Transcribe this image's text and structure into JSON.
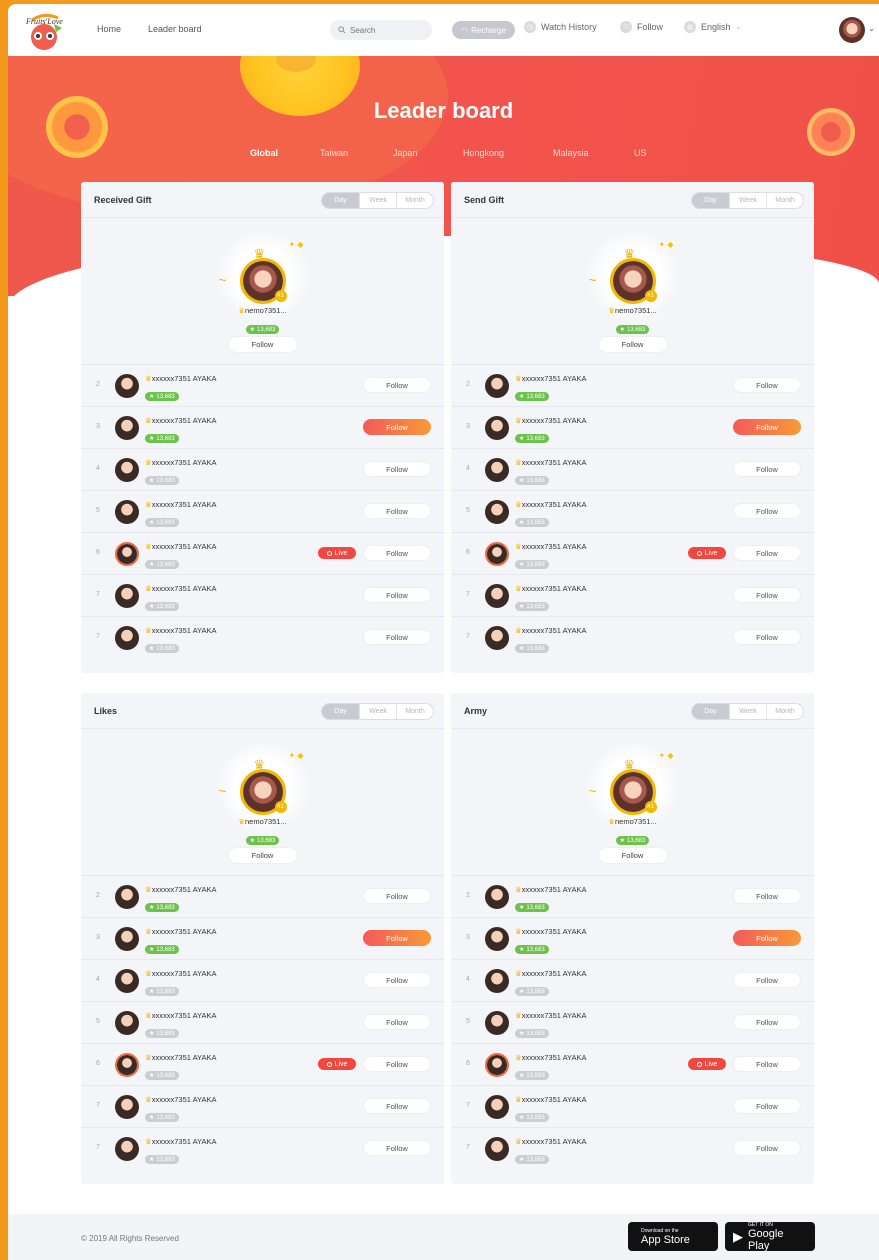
{
  "nav": {
    "home": "Home",
    "leaderboard": "Leader board",
    "search_placeholder": "Search",
    "recharge": "Recharge",
    "watch_history": "Watch History",
    "follow": "Follow",
    "language": "English"
  },
  "hero": {
    "title": "Leader board",
    "regions": [
      "Global",
      "Taiwan",
      "Japan",
      "Hongkong",
      "Malaysia",
      "US"
    ],
    "active_region": "Global"
  },
  "periods": [
    "Day",
    "Week",
    "Month"
  ],
  "panels": [
    {
      "title": "Received Gift",
      "top": {
        "name": "nemo7351...",
        "score": "13,683",
        "follow": "Follow"
      },
      "rows": [
        {
          "rank": "2",
          "name": "xxxxxx7351 AYAKA",
          "score": "13,683",
          "scoreColor": "green",
          "follow": "Follow",
          "hot": false,
          "live": false
        },
        {
          "rank": "3",
          "name": "xxxxxx7351 AYAKA",
          "score": "13,683",
          "scoreColor": "green",
          "follow": "Follow",
          "hot": true,
          "live": false
        },
        {
          "rank": "4",
          "name": "xxxxxx7351 AYAKA",
          "score": "13,683",
          "scoreColor": "grey",
          "follow": "Follow",
          "hot": false,
          "live": false
        },
        {
          "rank": "5",
          "name": "xxxxxx7351 AYAKA",
          "score": "13,683",
          "scoreColor": "grey",
          "follow": "Follow",
          "hot": false,
          "live": false
        },
        {
          "rank": "6",
          "name": "xxxxxx7351 AYAKA",
          "score": "13,683",
          "scoreColor": "grey",
          "follow": "Follow",
          "hot": false,
          "live": true,
          "live_label": "Live"
        },
        {
          "rank": "7",
          "name": "xxxxxx7351 AYAKA",
          "score": "13,683",
          "scoreColor": "grey",
          "follow": "Follow",
          "hot": false,
          "live": false
        },
        {
          "rank": "7",
          "name": "xxxxxx7351 AYAKA",
          "score": "13,683",
          "scoreColor": "grey",
          "follow": "Follow",
          "hot": false,
          "live": false
        }
      ]
    },
    {
      "title": "Send Gift",
      "top": {
        "name": "nemo7351...",
        "score": "13,683",
        "follow": "Follow"
      },
      "rows": [
        {
          "rank": "2",
          "name": "xxxxxx7351 AYAKA",
          "score": "13,683",
          "scoreColor": "green",
          "follow": "Follow",
          "hot": false,
          "live": false
        },
        {
          "rank": "3",
          "name": "xxxxxx7351 AYAKA",
          "score": "13,683",
          "scoreColor": "green",
          "follow": "Follow",
          "hot": true,
          "live": false
        },
        {
          "rank": "4",
          "name": "xxxxxx7351 AYAKA",
          "score": "13,683",
          "scoreColor": "grey",
          "follow": "Follow",
          "hot": false,
          "live": false
        },
        {
          "rank": "5",
          "name": "xxxxxx7351 AYAKA",
          "score": "13,683",
          "scoreColor": "grey",
          "follow": "Follow",
          "hot": false,
          "live": false
        },
        {
          "rank": "6",
          "name": "xxxxxx7351 AYAKA",
          "score": "13,683",
          "scoreColor": "grey",
          "follow": "Follow",
          "hot": false,
          "live": true,
          "live_label": "Live"
        },
        {
          "rank": "7",
          "name": "xxxxxx7351 AYAKA",
          "score": "13,683",
          "scoreColor": "grey",
          "follow": "Follow",
          "hot": false,
          "live": false
        },
        {
          "rank": "7",
          "name": "xxxxxx7351 AYAKA",
          "score": "13,683",
          "scoreColor": "grey",
          "follow": "Follow",
          "hot": false,
          "live": false
        }
      ]
    },
    {
      "title": "Likes",
      "top": {
        "name": "nemo7351...",
        "score": "13,683",
        "follow": "Follow"
      },
      "rows": [
        {
          "rank": "2",
          "name": "xxxxxx7351 AYAKA",
          "score": "13,683",
          "scoreColor": "green",
          "follow": "Follow",
          "hot": false,
          "live": false
        },
        {
          "rank": "3",
          "name": "xxxxxx7351 AYAKA",
          "score": "13,683",
          "scoreColor": "green",
          "follow": "Follow",
          "hot": true,
          "live": false
        },
        {
          "rank": "4",
          "name": "xxxxxx7351 AYAKA",
          "score": "13,683",
          "scoreColor": "grey",
          "follow": "Follow",
          "hot": false,
          "live": false
        },
        {
          "rank": "5",
          "name": "xxxxxx7351 AYAKA",
          "score": "13,683",
          "scoreColor": "grey",
          "follow": "Follow",
          "hot": false,
          "live": false
        },
        {
          "rank": "6",
          "name": "xxxxxx7351 AYAKA",
          "score": "13,683",
          "scoreColor": "grey",
          "follow": "Follow",
          "hot": false,
          "live": true,
          "live_label": "Live"
        },
        {
          "rank": "7",
          "name": "xxxxxx7351 AYAKA",
          "score": "13,683",
          "scoreColor": "grey",
          "follow": "Follow",
          "hot": false,
          "live": false
        },
        {
          "rank": "7",
          "name": "xxxxxx7351 AYAKA",
          "score": "13,683",
          "scoreColor": "grey",
          "follow": "Follow",
          "hot": false,
          "live": false
        }
      ]
    },
    {
      "title": "Army",
      "top": {
        "name": "nemo7351...",
        "score": "13,683",
        "follow": "Follow"
      },
      "rows": [
        {
          "rank": "2",
          "name": "xxxxxx7351 AYAKA",
          "score": "13,683",
          "scoreColor": "green",
          "follow": "Follow",
          "hot": false,
          "live": false
        },
        {
          "rank": "3",
          "name": "xxxxxx7351 AYAKA",
          "score": "13,683",
          "scoreColor": "green",
          "follow": "Follow",
          "hot": true,
          "live": false
        },
        {
          "rank": "4",
          "name": "xxxxxx7351 AYAKA",
          "score": "13,683",
          "scoreColor": "grey",
          "follow": "Follow",
          "hot": false,
          "live": false
        },
        {
          "rank": "5",
          "name": "xxxxxx7351 AYAKA",
          "score": "13,683",
          "scoreColor": "grey",
          "follow": "Follow",
          "hot": false,
          "live": false
        },
        {
          "rank": "6",
          "name": "xxxxxx7351 AYAKA",
          "score": "13,683",
          "scoreColor": "grey",
          "follow": "Follow",
          "hot": false,
          "live": true,
          "live_label": "Live"
        },
        {
          "rank": "7",
          "name": "xxxxxx7351 AYAKA",
          "score": "13,683",
          "scoreColor": "grey",
          "follow": "Follow",
          "hot": false,
          "live": false
        },
        {
          "rank": "7",
          "name": "xxxxxx7351 AYAKA",
          "score": "13,683",
          "scoreColor": "grey",
          "follow": "Follow",
          "hot": false,
          "live": false
        }
      ]
    }
  ],
  "footer": {
    "copyright": "© 2019 All Rights Reserved",
    "app_store_small": "Download on the",
    "app_store_big": "App Store",
    "google_play_small": "GET IT ON",
    "google_play_big": "Google Play"
  },
  "colors": {
    "brand_red": "#f0584c",
    "accent_orange": "#f39a1c",
    "gold": "#f5b800",
    "score_green": "#6cc24a",
    "live_red": "#f2473f"
  }
}
